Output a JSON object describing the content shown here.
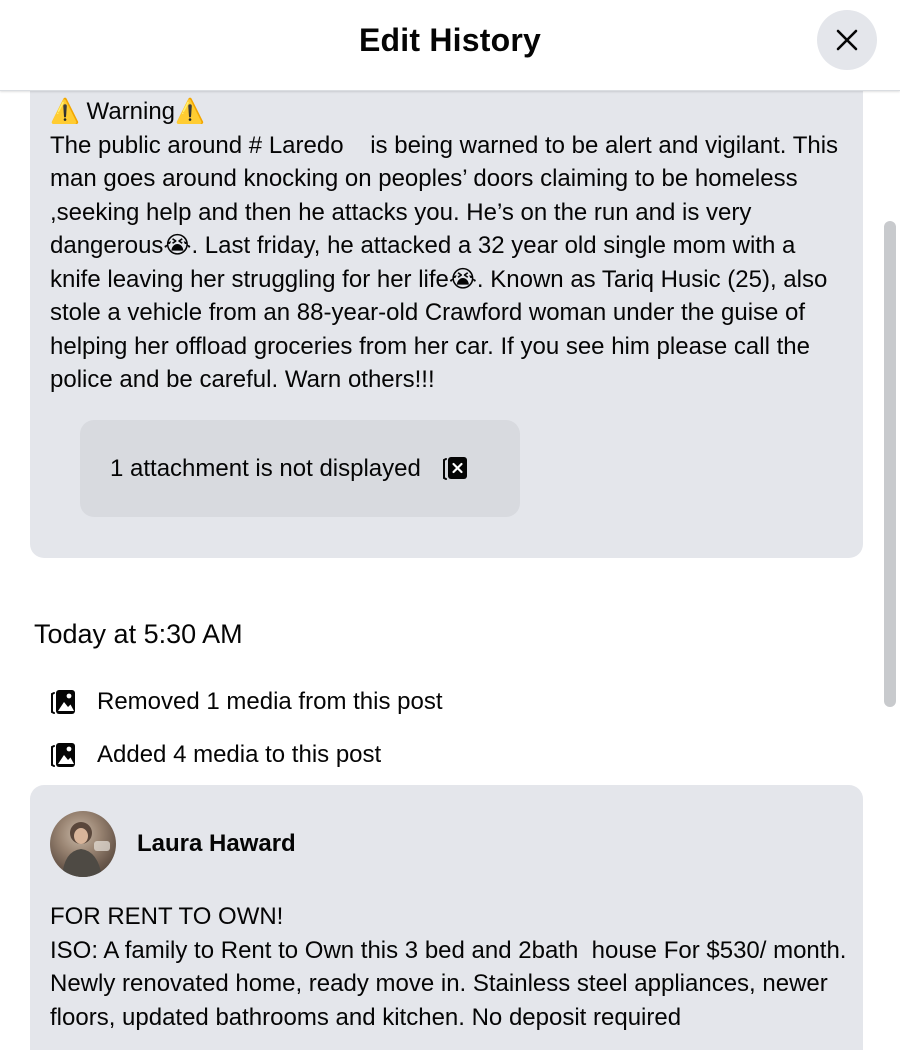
{
  "header": {
    "title": "Edit History",
    "close_icon": "close-icon"
  },
  "post_version_1": {
    "text": "⚠️ Warning⚠️\nThe public around # Laredo    is being warned to be alert and vigilant. This man goes around knocking on peoples’ doors claiming to be homeless ,seeking help and then he attacks you. He’s on the run and is very dangerous😭. Last friday, he attacked a 32 year old single mom with a knife leaving her struggling for her life😭. Known as Tariq Husic (25), also stole a vehicle from an 88-year-old Crawford woman under the guise of helping her offload groceries from her car. If you see him please call the police and be careful. Warn others!!!",
    "attachment_notice": "1 attachment is not displayed",
    "attachment_icon": "hidden-media-icon"
  },
  "revision": {
    "timestamp": "Today at 5:30 AM",
    "changes": [
      {
        "icon": "media-icon",
        "text": "Removed 1 media from this post"
      },
      {
        "icon": "media-icon",
        "text": "Added 4 media to this post"
      }
    ]
  },
  "post_version_2": {
    "author": "Laura Haward",
    "text": "FOR RENT TO OWN!\nISO: A family to Rent to Own this 3 bed and 2bath  house For $530/ month.\nNewly renovated home, ready move in. Stainless steel appliances, newer floors, updated bathrooms and kitchen. No deposit required"
  },
  "colors": {
    "card_bg": "#e4e6eb",
    "attachment_bg": "#d8dadf",
    "text": "#050505"
  }
}
